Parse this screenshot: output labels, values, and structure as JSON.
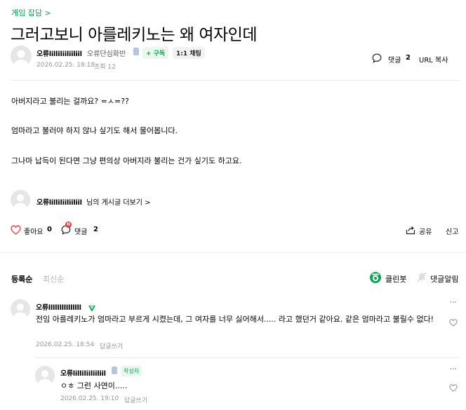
{
  "article": {
    "board": "게임 잡담 >",
    "title": "그러고보니 아를레키노는 왜 여자인데",
    "author": {
      "nickname": "오류lilliliiliiliil",
      "grade": "오류단심화반",
      "subscribe_label": "+ 구독",
      "chat_label": "1:1 채팅"
    },
    "date": "2026.02.25. 18:18",
    "views": "조회 12",
    "comment_label": "댓글",
    "comment_count": "2",
    "url_copy": "URL 복사",
    "body": [
      "아버지라고 불리는 걸까요? =ㅅ=??",
      "엄마라고 불러야 하지 않나 싶기도 해서 물어봅니다.",
      "그나마 납득이 된다면 그냥 편의상 아버지라 불리는 건가 싶기도 하고요."
    ],
    "more_posts": {
      "nickname": "오류lilliliiliiliil",
      "suffix": "님의 게시글 더보기 >"
    },
    "like_label": "좋아요",
    "like_count": "0",
    "comment_badge": "N",
    "share_label": "공유",
    "report_label": "신고"
  },
  "comments_section": {
    "sort_registered": "등록순",
    "sort_latest": "최신순",
    "cleanbot_label": "클린봇",
    "notify_label": "댓글알림",
    "comments": [
      {
        "nickname": "오류lllllllllllllll",
        "text": "전임 아를레키노가 엄마라고 부르게 시켰는데, 그 여자를 너무 싫어해서..... 라고 했던거 같아요. 같은 엄마라고 불릴수 없다!",
        "date": "2026.02.25. 18:54",
        "reply_label": "답글쓰기"
      },
      {
        "nickname": "오류lilliliiliiliil",
        "author_badge": "작성자",
        "text": "ㅇㅎ 그런 사연이.....",
        "date": "2026.02.25. 19:10",
        "reply_label": "답글쓰기"
      }
    ]
  },
  "colors": {
    "accent_green": "#03a94d",
    "meta_gray": "#979797",
    "heart_red": "#f53535",
    "divider": "#ebebeb"
  }
}
